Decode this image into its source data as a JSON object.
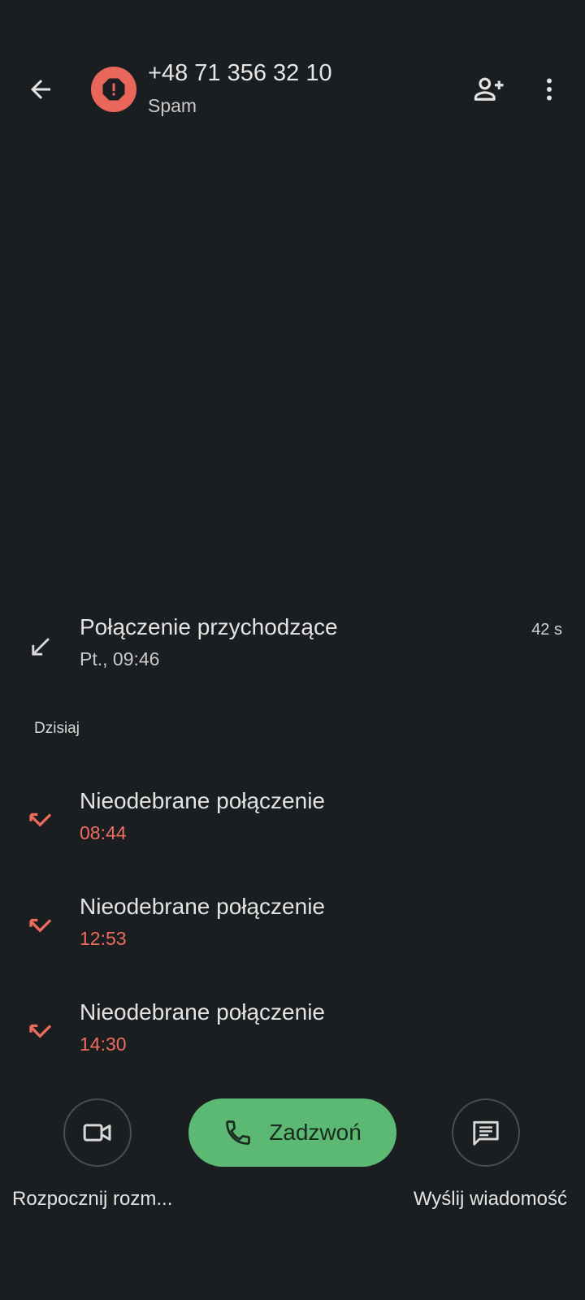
{
  "header": {
    "number": "+48 71 356 32 10",
    "subtitle": "Spam",
    "icons": [
      "back-arrow-icon",
      "spam-alert-icon",
      "add-person-icon",
      "more-vert-icon"
    ]
  },
  "calls": [
    {
      "title": "Połączenie przychodzące",
      "time": "Pt., 09:46",
      "duration": "42 s",
      "type": "incoming"
    }
  ],
  "section": {
    "label": "Dzisiaj"
  },
  "today_calls": [
    {
      "title": "Nieodebrane połączenie",
      "time": "08:44",
      "type": "missed"
    },
    {
      "title": "Nieodebrane połączenie",
      "time": "12:53",
      "type": "missed"
    },
    {
      "title": "Nieodebrane połączenie",
      "time": "14:30",
      "type": "missed"
    }
  ],
  "actions": {
    "video_label": "Rozpocznij rozm...",
    "call_label": "Zadzwoń",
    "message_label": "Wyślij wiadomość"
  },
  "colors": {
    "background": "#1b1e21",
    "spam_red": "#e8675a",
    "missed_red": "#ec6d5f",
    "call_green": "#5cb974"
  }
}
